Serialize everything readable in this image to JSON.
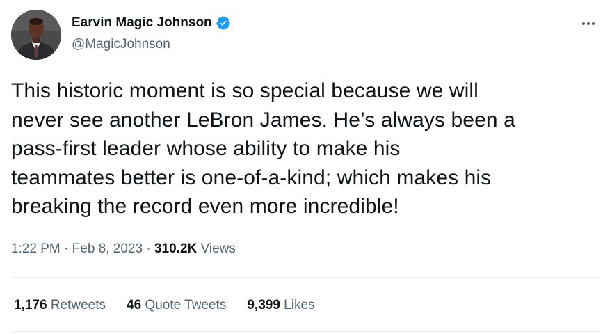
{
  "author": {
    "display_name": "Earvin Magic Johnson",
    "handle": "@MagicJohnson",
    "verified": true
  },
  "tweet": {
    "lines": [
      "This historic moment is so special because we will",
      "never see another LeBron James. He’s always been a",
      "pass-first leader whose ability to make his",
      "teammates better is one-of-a-kind; which makes his",
      "breaking the record even more incredible!"
    ]
  },
  "meta": {
    "time": "1:22 PM",
    "sep1": " · ",
    "date": "Feb 8, 2023",
    "sep2": " · ",
    "views_count": "310.2K",
    "views_label": " Views"
  },
  "stats": {
    "retweets_count": "1,176",
    "retweets_label": " Retweets",
    "quotes_count": "46",
    "quotes_label": " Quote Tweets",
    "likes_count": "9,399",
    "likes_label": " Likes"
  },
  "colors": {
    "text_primary": "#0f1419",
    "text_secondary": "#536471",
    "verified_blue": "#1d9bf0",
    "divider": "#eff3f4"
  },
  "icons": {
    "verified": "verified-badge-icon",
    "more": "more-horizontal-icon"
  }
}
